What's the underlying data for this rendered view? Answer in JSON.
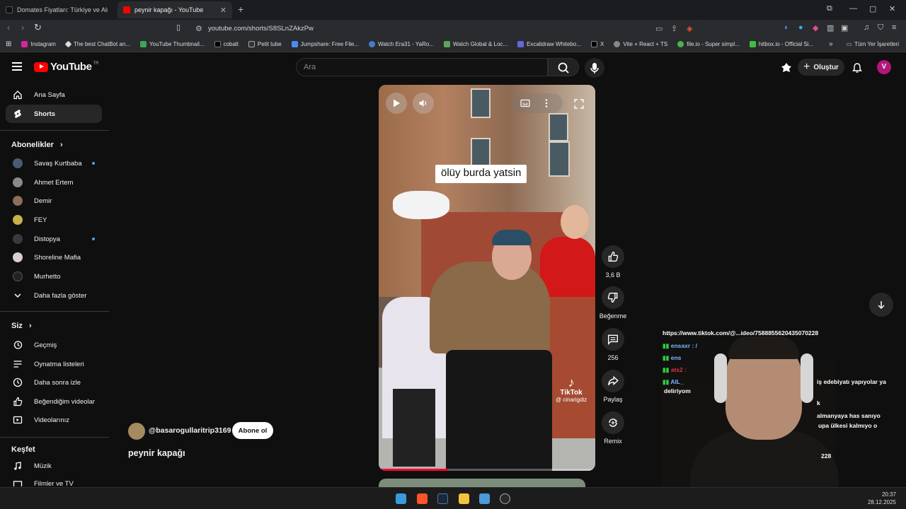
{
  "browser": {
    "tabs": [
      {
        "title": "Domates Fiyatları: Türkiye ve Almany",
        "active": false
      },
      {
        "title": "peynir kapağı - YouTube",
        "active": true
      }
    ],
    "url": "youtube.com/shorts/S8SLnZAkzPw",
    "bookmarks": [
      "Instagram",
      "The best ChatBot an...",
      "YouTube Thumbnail...",
      "cobalt",
      "Petit tube",
      "Jumpshare: Free File...",
      "Watch Era31 - YaRo...",
      "Watch Global & Loc...",
      "Excalidraw Whitebo...",
      "X",
      "Vite + React + TS",
      "file.io - Super simpl...",
      "hitbox.io - Official Si..."
    ],
    "bookmarks_all": "Tüm Yer İşaretleri"
  },
  "youtube": {
    "logo_text": "YouTube",
    "logo_region": "TR",
    "search_placeholder": "Ara",
    "create_label": "Oluştur",
    "avatar_letter": "V"
  },
  "sidebar": {
    "main": [
      {
        "label": "Ana Sayfa",
        "icon": "home-icon"
      },
      {
        "label": "Shorts",
        "icon": "shorts-icon",
        "active": true
      }
    ],
    "subscriptions_title": "Abonelikler",
    "subscriptions": [
      {
        "label": "Savaş Kurtbaba",
        "new": true
      },
      {
        "label": "Ahmet Ertem",
        "new": false
      },
      {
        "label": "Demir",
        "new": false
      },
      {
        "label": "FEY",
        "new": false
      },
      {
        "label": "Distopya",
        "new": true
      },
      {
        "label": "Shoreline Mafia",
        "new": false
      },
      {
        "label": "Murhetto",
        "new": false
      }
    ],
    "show_more": "Daha fazla göster",
    "you_title": "Siz",
    "you": [
      "Geçmiş",
      "Oynatma listeleri",
      "Daha sonra izle",
      "Beğendiğim videolar",
      "Videolarınız"
    ],
    "explore_title": "Keşfet",
    "explore": [
      "Müzik",
      "Filmler ve TV"
    ]
  },
  "video": {
    "caption": "ölüy burda yatsin",
    "watermark": "TikTok",
    "watermark_handle": "@ cinarigdiz",
    "progress": 0.32
  },
  "actions": {
    "likes": "3,6 B",
    "dislike": "Beğenme",
    "comments": "256",
    "share": "Paylaş",
    "remix": "Remix"
  },
  "channel": {
    "handle": "@basarogullaritrip3169",
    "subscribe": "Abone ol",
    "title": "peynir kapağı"
  },
  "chat": [
    "https://www.tiktok.com/@...ideo/7588855620435070228",
    "ensaxr : /",
    "ens",
    "ats2 :",
    "AlL_",
    "iş edebiyatı yapıyolar ya",
    "deliriyom",
    "k",
    "almanyaya has sanıyo",
    "upa ülkesi kalmıyo o",
    "228"
  ],
  "taskbar": {
    "time": "20:37",
    "date": "28.12.2025"
  }
}
